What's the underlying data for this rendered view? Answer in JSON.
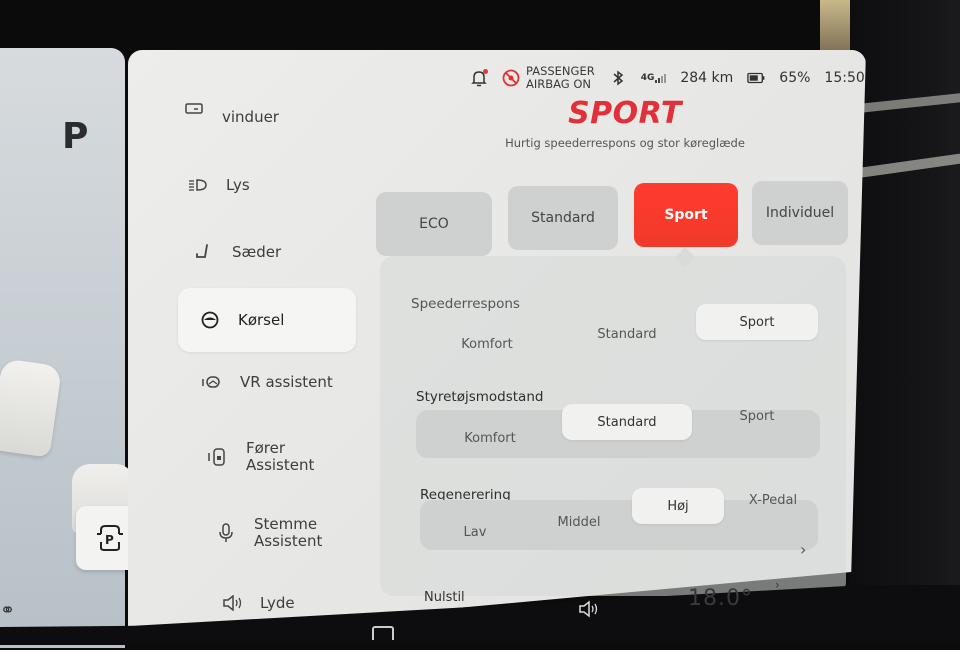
{
  "status_bar": {
    "notification_icon": "bell-icon",
    "airbag_line1": "PASSENGER",
    "airbag_line2": "AIRBAG ON",
    "bluetooth_icon": "bluetooth-icon",
    "network": "4G",
    "range": "284 km",
    "battery_percent": "65%",
    "time": "15:50"
  },
  "drive_mode": {
    "title": "SPORT",
    "subtitle": "Hurtig speederrespons og stor køreglæde",
    "modes": [
      {
        "label": "ECO",
        "selected": false
      },
      {
        "label": "Standard",
        "selected": false
      },
      {
        "label": "Sport",
        "selected": true
      },
      {
        "label": "Individuel",
        "selected": false
      }
    ],
    "accent_color": "#f03a2a"
  },
  "left_panel": {
    "gear": "P",
    "park_button_icon": "auto-park-icon"
  },
  "sidebar": {
    "items": [
      {
        "label": "vinduer",
        "icon": "window-icon",
        "active": false
      },
      {
        "label": "Lys",
        "icon": "headlight-icon",
        "active": false
      },
      {
        "label": "Sæder",
        "icon": "seat-icon",
        "active": false
      },
      {
        "label": "Kørsel",
        "icon": "steering-wheel-icon",
        "active": true
      },
      {
        "label": "VR assistent",
        "icon": "vr-assistant-icon",
        "active": false
      },
      {
        "label_line1": "Fører",
        "label_line2": "Assistent",
        "icon": "driver-assist-icon",
        "active": false
      },
      {
        "label_line1": "Stemme",
        "label_line2": "Assistent",
        "icon": "microphone-icon",
        "active": false
      },
      {
        "label": "Lyde",
        "icon": "speaker-icon",
        "active": false
      }
    ]
  },
  "settings": {
    "speederrespons": {
      "label": "Speederrespons",
      "options": [
        "Komfort",
        "Standard",
        "Sport"
      ],
      "selected": "Sport"
    },
    "styretoejsmodstand": {
      "label": "Styretøjsmodstand",
      "options": [
        "Komfort",
        "Standard",
        "Sport"
      ],
      "selected": "Standard"
    },
    "regenerering": {
      "label": "Regenerering",
      "options": [
        "Lav",
        "Middel",
        "Høj",
        "X-Pedal"
      ],
      "selected": "Høj"
    },
    "reset_label": "Nulstil"
  },
  "dock": {
    "temperature": "18.0°"
  }
}
